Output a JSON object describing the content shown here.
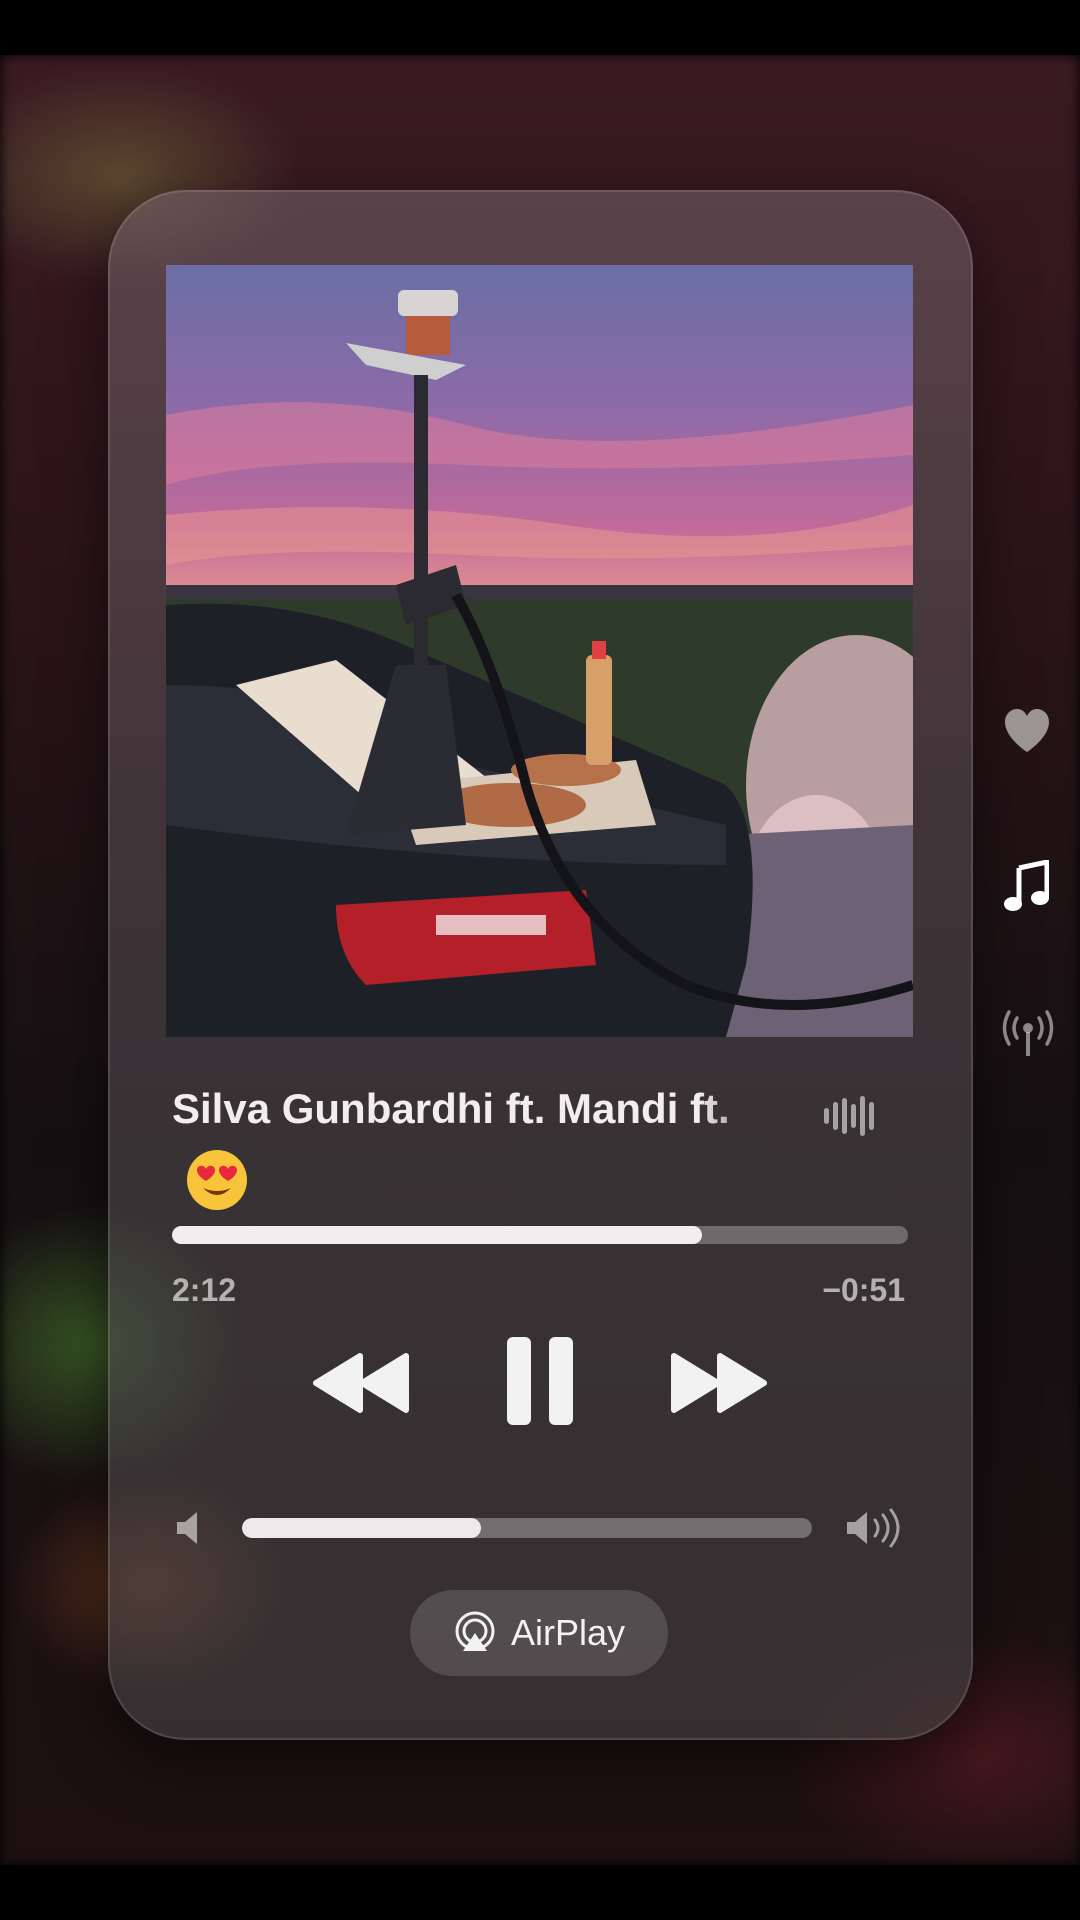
{
  "track": {
    "title": "Silva Gunbardhi ft. Mandi ft. ",
    "emoji": "heart-eyes-emoji",
    "artwork": "album-artwork"
  },
  "playback": {
    "elapsed": "2:12",
    "remaining": "−0:51",
    "progress_fraction": 0.72,
    "state": "playing"
  },
  "volume": {
    "level_fraction": 0.42
  },
  "airplay": {
    "label": "AirPlay"
  },
  "side_icons": [
    "heart-icon",
    "music-note-icon",
    "broadcast-icon"
  ],
  "colors": {
    "accent": "#f1eeee",
    "card": "#5a5057"
  }
}
